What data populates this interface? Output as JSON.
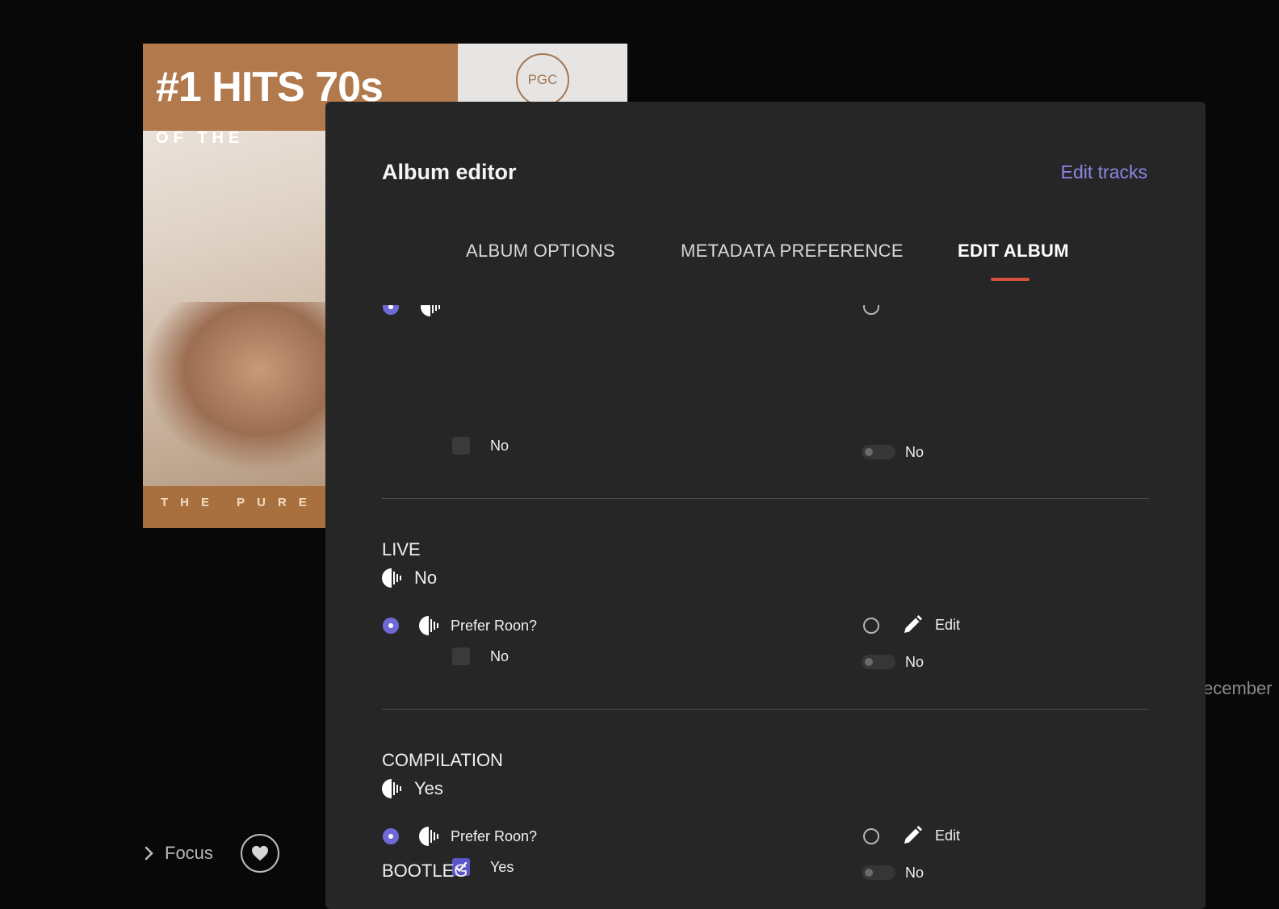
{
  "background": {
    "cover": {
      "title_big": "#1 HITS",
      "title_small": "OF THE",
      "title_decade": "70s",
      "logo": "PGC",
      "tagline": "THE PURE"
    },
    "focus_label": "Focus",
    "date_peek": "ecember"
  },
  "modal": {
    "title": "Album editor",
    "edit_tracks_link": "Edit tracks",
    "tabs": [
      {
        "label": "ALBUM OPTIONS",
        "active": false
      },
      {
        "label": "METADATA PREFERENCE",
        "active": false
      },
      {
        "label": "EDIT ALBUM",
        "active": true
      }
    ],
    "sections": {
      "previous": {
        "roon_checkbox_label": "No",
        "edit_toggle_label": "No"
      },
      "live": {
        "title": "LIVE",
        "value": "No",
        "prefer_roon_label": "Prefer Roon?",
        "roon_checkbox_label": "No",
        "roon_checked": false,
        "edit_label": "Edit",
        "edit_toggle_label": "No"
      },
      "compilation": {
        "title": "COMPILATION",
        "value": "Yes",
        "prefer_roon_label": "Prefer Roon?",
        "roon_checkbox_label": "Yes",
        "roon_checked": true,
        "edit_label": "Edit",
        "edit_toggle_label": "No"
      },
      "bootleg": {
        "title": "BOOTLEG"
      }
    }
  },
  "colors": {
    "accent": "#6f69d6",
    "link": "#8c86e6",
    "tab_underline": "#d4503f",
    "modal_bg": "#262626",
    "page_bg": "#080808"
  },
  "icons": [
    "roon-icon",
    "pencil-icon",
    "heart-icon",
    "chevron-right-icon",
    "check-icon"
  ]
}
